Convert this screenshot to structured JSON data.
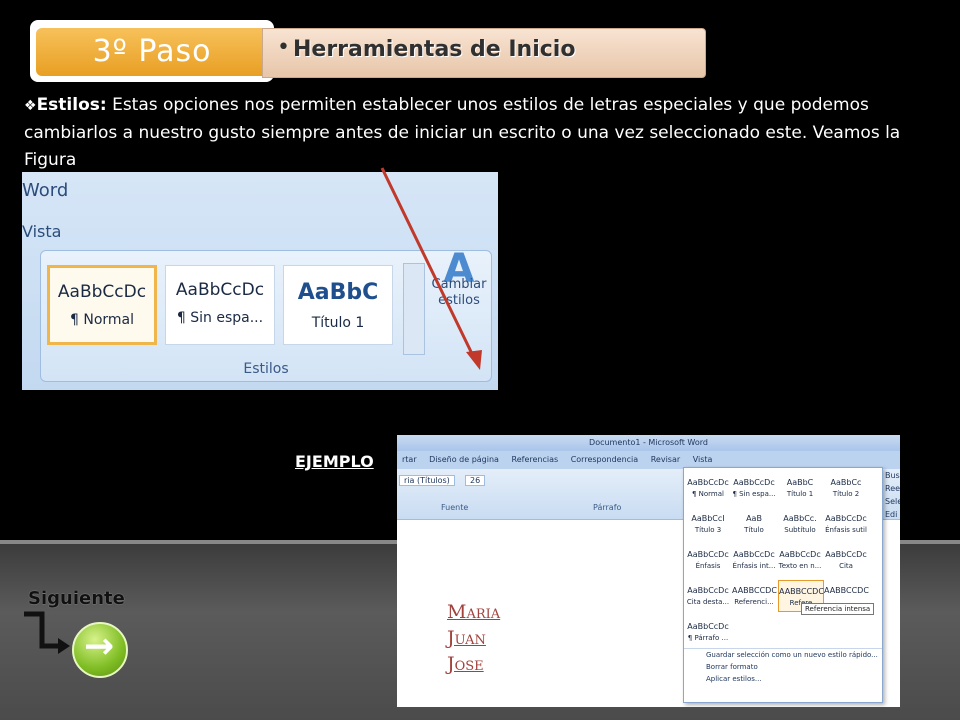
{
  "header": {
    "step_label": "3º  Paso",
    "section_title": "Herramientas de Inicio"
  },
  "intro": {
    "label": "Estilos:",
    "text": " Estas opciones nos permiten establecer unos estilos de letras especiales y que podemos cambiarlos a nuestro gusto siempre antes de iniciar un escrito o una vez seleccionado este. Veamos la Figura"
  },
  "ribbon1": {
    "app_tab": "Word",
    "view_tab": "Vista",
    "styles": [
      {
        "sample": "AaBbCcDc",
        "name": "¶ Normal"
      },
      {
        "sample": "AaBbCcDc",
        "name": "¶ Sin espa..."
      },
      {
        "sample": "AaBbC",
        "name": "Título 1"
      }
    ],
    "change_styles": "Cambiar estilos",
    "group_label": "Estilos"
  },
  "example_label": "EJEMPLO",
  "word2": {
    "title": "Documento1 - Microsoft Word",
    "menu": [
      "rtar",
      "Diseño de página",
      "Referencias",
      "Correspondencia",
      "Revisar",
      "Vista"
    ],
    "font_name": "ria (Títulos)",
    "font_size": "26",
    "group_font": "Fuente",
    "group_paragraph": "Párrafo",
    "right_panel": [
      "Busc",
      "Reem",
      "Sele",
      "Edi"
    ],
    "names": [
      "Maria",
      "Juan",
      "Jose"
    ],
    "styles": [
      {
        "sample": "AaBbCcDc",
        "name": "¶ Normal"
      },
      {
        "sample": "AaBbCcDc",
        "name": "¶ Sin espa..."
      },
      {
        "sample": "AaBbC",
        "name": "Título 1"
      },
      {
        "sample": "AaBbCc",
        "name": "Título 2"
      },
      {
        "sample": "AaBbCcI",
        "name": "Título 3"
      },
      {
        "sample": "AaB",
        "name": "Título"
      },
      {
        "sample": "AaBbCc.",
        "name": "Subtítulo"
      },
      {
        "sample": "AaBbCcDc",
        "name": "Énfasis sutil"
      },
      {
        "sample": "AaBbCcDc",
        "name": "Énfasis"
      },
      {
        "sample": "AaBbCcDc",
        "name": "Énfasis int..."
      },
      {
        "sample": "AaBbCcDc",
        "name": "Texto en n..."
      },
      {
        "sample": "AaBbCcDc",
        "name": "Cita"
      },
      {
        "sample": "AaBbCcDc",
        "name": "Cita desta..."
      },
      {
        "sample": "AABBCCDC",
        "name": "Referenci..."
      },
      {
        "sample": "AABBCCDC",
        "name": "Refere"
      },
      {
        "sample": "AABBCCDC",
        "name": ""
      },
      {
        "sample": "AaBbCcDc",
        "name": "¶ Párrafo ..."
      }
    ],
    "tooltip": "Referencia intensa",
    "menu_items": [
      "Guardar selección como un nuevo estilo rápido...",
      "Borrar formato",
      "Aplicar estilos..."
    ]
  },
  "nav": {
    "next_label": "Siguiente"
  }
}
